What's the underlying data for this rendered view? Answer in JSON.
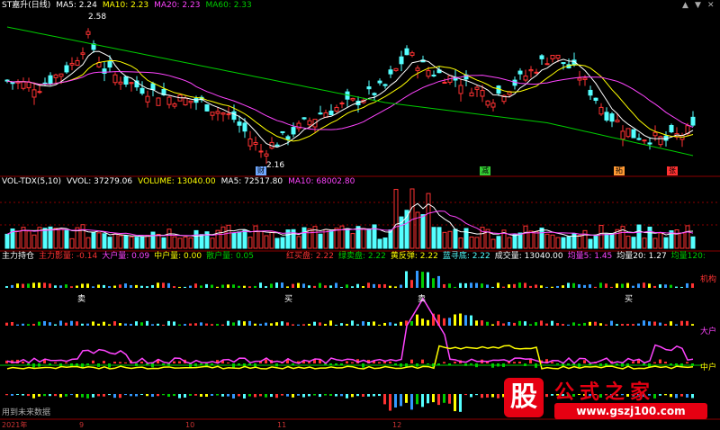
{
  "price_header": {
    "title": "ST嘉升(日线)",
    "ma5": "MA5: 2.24",
    "ma10": "MA10: 2.23",
    "ma20": "MA20: 2.23",
    "ma60": "MA60: 2.33"
  },
  "volume_header": {
    "name": "VOL-TDX(5,10)",
    "vvol": "VVOL: 37279.06",
    "volume": "VOLUME: 13040.00",
    "ma5": "MA5: 72517.80",
    "ma10": "MA10: 68002.80"
  },
  "indicator_header": {
    "name": "主力持仓",
    "zhuli": "主力影量: -0.14",
    "dahu": "大户量: 0.09",
    "zhonghu": "中户量: 0.00",
    "sanhu": "散户量: 0.05",
    "hongmai": "红买盘: 2.22",
    "lvmai": "绿卖盘: 2.22",
    "huangfan": "黄反弹: 2.22",
    "lanxun": "蓝寻底: 2.22",
    "chengjiao": "成交量: 13040.00",
    "junliang5": "均量5: 1.45",
    "junliang20": "均量20: 1.27",
    "junliang120": "均量120:"
  },
  "annotations": {
    "high_price": "2.58",
    "low_price": "2.16",
    "marker_cai": "财",
    "marker_jian": "减",
    "marker_tuo": "拓",
    "marker_zhang": "张",
    "sell1": "卖",
    "buy1": "买",
    "sell2": "卖",
    "buy2": "买"
  },
  "right_labels": {
    "jigou": "机构",
    "dahu": "大户",
    "zhonghu": "中户"
  },
  "footer": {
    "future_data": "用到未来数据",
    "year": "2021年",
    "m9": "9",
    "m10": "10",
    "m11": "11",
    "m12": "12"
  },
  "logo": {
    "badge": "股",
    "title": "公式之家",
    "url": "www.gszj100.com"
  },
  "window_controls": {
    "up": "▲",
    "down": "▼",
    "close": "✕"
  },
  "colors": {
    "up": "#ff3232",
    "down": "#54ffff",
    "ma5": "#ffffff",
    "ma10": "#ffff00",
    "ma20": "#ff44ff",
    "ma60": "#00cc00",
    "grid": "#8b0000"
  }
}
